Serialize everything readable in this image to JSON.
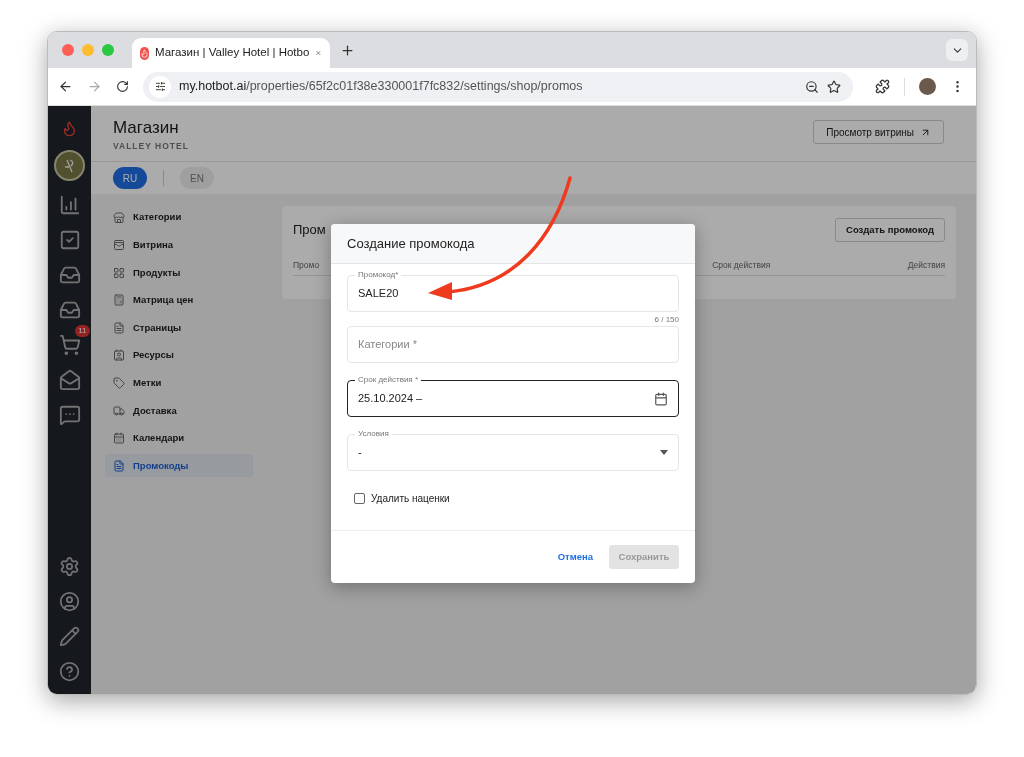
{
  "browser": {
    "tab_title": "Магазин | Valley Hotel | Hotbo",
    "url_host": "my.hotbot.ai",
    "url_path": "/properties/65f2c01f38e330001f7fc832/settings/shop/promos"
  },
  "sidebar": {
    "cart_badge": "11"
  },
  "header": {
    "title": "Магазин",
    "subtitle": "VALLEY HOTEL",
    "showcase_button": "Просмотр витрины"
  },
  "languages": [
    {
      "label": "RU",
      "selected": true
    },
    {
      "label": "EN",
      "selected": false
    }
  ],
  "nav": [
    {
      "label": "Категории",
      "selected": false
    },
    {
      "label": "Витрина",
      "selected": false
    },
    {
      "label": "Продукты",
      "selected": false
    },
    {
      "label": "Матрица цен",
      "selected": false
    },
    {
      "label": "Страницы",
      "selected": false
    },
    {
      "label": "Ресурсы",
      "selected": false
    },
    {
      "label": "Метки",
      "selected": false
    },
    {
      "label": "Доставка",
      "selected": false
    },
    {
      "label": "Календари",
      "selected": false
    },
    {
      "label": "Промокоды",
      "selected": true
    }
  ],
  "card": {
    "title": "Пром",
    "create_button": "Создать промокод",
    "columns": [
      "Промо",
      "Срок действия",
      "Действия"
    ]
  },
  "modal": {
    "title": "Создание промокода",
    "fields": [
      {
        "kind": "text",
        "label": "Промокод*",
        "value": "SALE20",
        "counter": "6 / 150",
        "focused": false
      },
      {
        "kind": "text",
        "placeholder": "Категории *",
        "focused": false
      },
      {
        "kind": "date",
        "label": "Срок действия *",
        "value": "25.10.2024 –",
        "focused": true
      },
      {
        "kind": "select",
        "label": "Условия",
        "value": "-",
        "focused": false
      }
    ],
    "checkbox": {
      "label": "Удалить наценки",
      "checked": false
    },
    "cancel_button": "Отмена",
    "save_button": {
      "label": "Сохранить",
      "disabled": true
    }
  }
}
